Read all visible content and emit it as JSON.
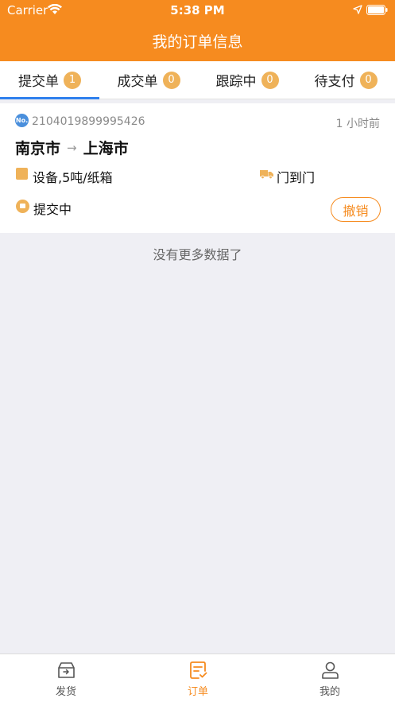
{
  "status_bar": {
    "carrier": "Carrier",
    "time": "5:38 PM"
  },
  "nav": {
    "title": "我的订单信息"
  },
  "tabs": [
    {
      "label": "提交单",
      "count": "1"
    },
    {
      "label": "成交单",
      "count": "0"
    },
    {
      "label": "跟踪中",
      "count": "0"
    },
    {
      "label": "待支付",
      "count": "0"
    }
  ],
  "order": {
    "no_badge": "No.",
    "number": "2104019899995426",
    "time": "1 小时前",
    "from": "南京市",
    "arrow": "→",
    "to": "上海市",
    "goods": "设备,5吨/纸箱",
    "delivery": "门到门",
    "status": "提交中",
    "cancel_label": "撤销"
  },
  "list": {
    "no_more": "没有更多数据了"
  },
  "tabbar": [
    {
      "label": "发货"
    },
    {
      "label": "订单"
    },
    {
      "label": "我的"
    }
  ],
  "colors": {
    "brand": "#f68b1f",
    "badge": "#efb259",
    "indicator": "#2f80ed"
  }
}
